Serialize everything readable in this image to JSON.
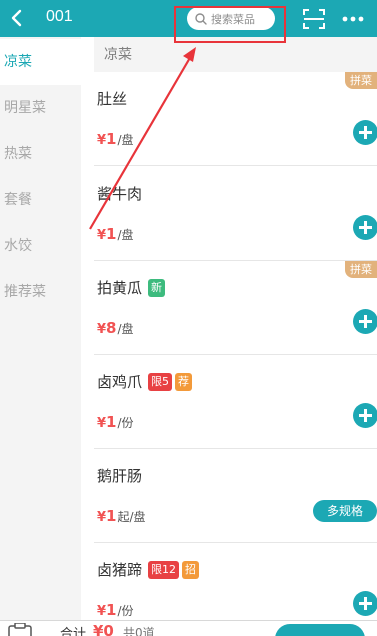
{
  "header": {
    "table_no": "001",
    "search_placeholder": "搜索菜品"
  },
  "sidebar": {
    "categories": [
      {
        "label": "凉菜",
        "active": true
      },
      {
        "label": "明星菜",
        "active": false
      },
      {
        "label": "热菜",
        "active": false
      },
      {
        "label": "套餐",
        "active": false
      },
      {
        "label": "水饺",
        "active": false
      },
      {
        "label": "推荐菜",
        "active": false
      }
    ]
  },
  "section": {
    "title": "凉菜"
  },
  "dishes": [
    {
      "name": "肚丝",
      "price": "1",
      "unit": "/盘",
      "corner_tag": "拼菜"
    },
    {
      "name": "酱牛肉",
      "price": "1",
      "unit": "/盘"
    },
    {
      "name": "拍黄瓜",
      "price": "8",
      "unit": "/盘",
      "tag": "新",
      "corner_tag": "拼菜"
    },
    {
      "name": "卤鸡爪",
      "price": "1",
      "unit": "/份",
      "tags": [
        "限5",
        "荐"
      ]
    },
    {
      "name": "鹅肝肠",
      "price": "1",
      "unit": "起/盘",
      "spec_button": "多规格"
    },
    {
      "name": "卤猪蹄",
      "price": "1",
      "unit": "/份",
      "tags": [
        "限12",
        "招"
      ]
    }
  ],
  "bottom": {
    "total_label": "合计",
    "total_amount": "¥0",
    "total_count": "共0道"
  },
  "colors": {
    "accent": "#1ca8b4",
    "price": "#f15353",
    "annotation": "#e8343a"
  }
}
